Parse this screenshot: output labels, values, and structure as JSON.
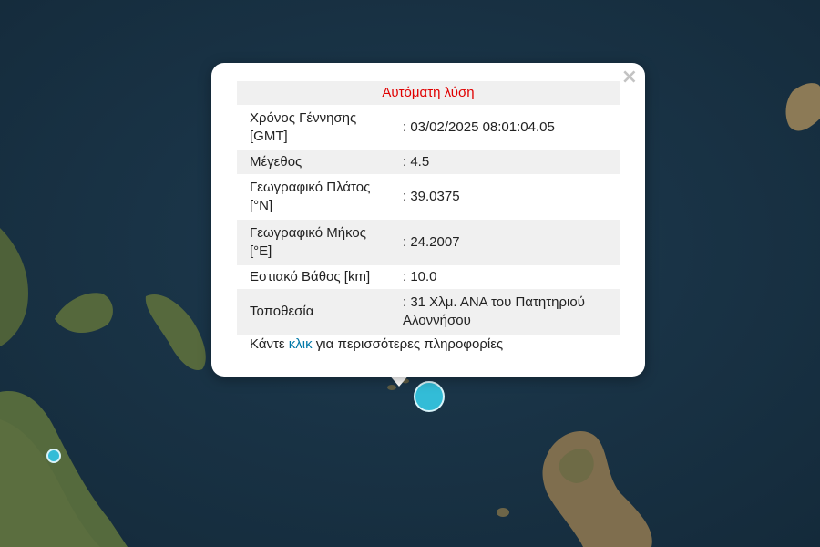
{
  "popup": {
    "title": "Αυτόματη λύση",
    "close_glyph": "×",
    "rows": [
      {
        "label": "Χρόνος Γέννησης [GMT]",
        "value": ": 03/02/2025 08:01:04.05"
      },
      {
        "label": "Μέγεθος",
        "value": ": 4.5"
      },
      {
        "label": "Γεωγραφικό Πλάτος [°N]",
        "value": ": 39.0375"
      },
      {
        "label": "Γεωγραφικό Μήκος [°E]",
        "value": ": 24.2007"
      },
      {
        "label": "Εστιακό Βάθος [km]",
        "value": ": 10.0"
      },
      {
        "label": "Τοποθεσία",
        "value": ": 31 Χλμ. ΑΝΑ του Πατητηριού Αλοννήσου"
      }
    ],
    "more_prefix": "Κάντε ",
    "more_link": "κλικ",
    "more_suffix": " για περισσότερες πληροφορίες"
  },
  "colors": {
    "sea": "#1a3446",
    "land": "#4d5f3a",
    "marker": "#33bcd7",
    "title_text": "#e00000",
    "link": "#0078a8"
  },
  "icons": {
    "close": "close-icon"
  }
}
